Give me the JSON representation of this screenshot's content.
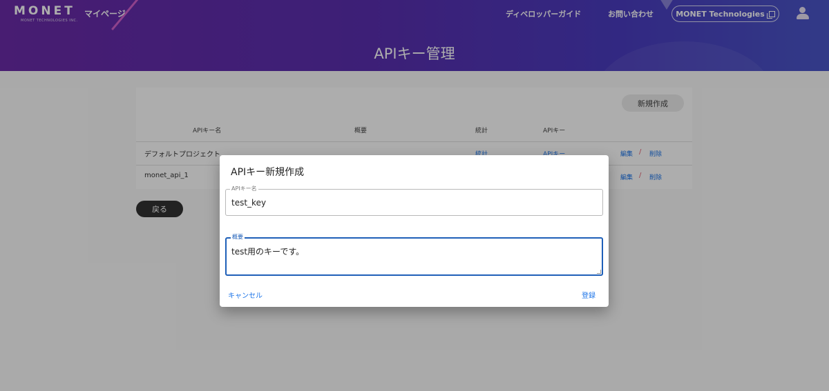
{
  "header": {
    "logo_text": "MONET",
    "logo_sub": "MONET TECHNOLOGIES INC.",
    "nav_mypage": "マイページ",
    "nav_guide": "ディベロッパーガイド",
    "nav_contact": "お問い合わせ",
    "nav_company": "MONET Technologies",
    "page_title": "APIキー管理"
  },
  "toolbar": {
    "new_label": "新規作成"
  },
  "table": {
    "columns": [
      "APIキー名",
      "概要",
      "統計",
      "APIキー"
    ],
    "rows": [
      {
        "name": "デフォルトプロジェクト",
        "stats": "統計",
        "apikey": "APIキー",
        "edit": "編集",
        "separator": "/",
        "delete": "削除"
      },
      {
        "name": "monet_api_1",
        "edit": "編集",
        "separator": "/",
        "delete": "削除"
      }
    ]
  },
  "back_label": "戻る",
  "dialog": {
    "title": "APIキー新規作成",
    "name_field": {
      "label": "APIキー名",
      "value": "test_key"
    },
    "desc_field": {
      "label": "概要",
      "value": "test用のキーです。"
    },
    "cancel_label": "キャンセル",
    "submit_label": "登録"
  },
  "colors": {
    "header_start": "#6a2ba8",
    "header_end": "#4a56c8",
    "link": "#1a73e8",
    "focus": "#1e5fb8"
  }
}
